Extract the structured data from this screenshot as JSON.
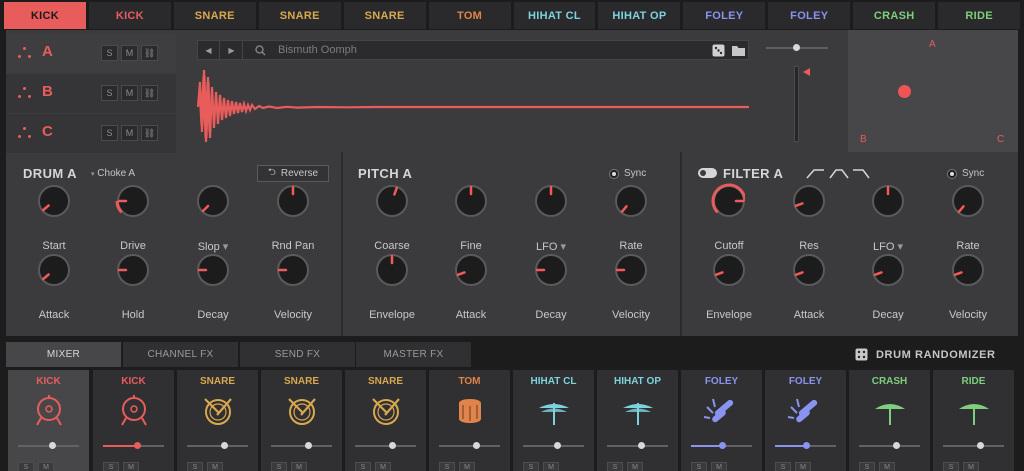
{
  "colors": {
    "kick": "#e95c5c",
    "snare": "#d9a84e",
    "tom": "#e0844b",
    "hihat": "#7cd3de",
    "foley": "#8a93ef",
    "crash": "#7fce7d",
    "ride": "#7fce7d"
  },
  "top_tabs": [
    {
      "label": "KICK",
      "color": "#e95c5c",
      "active": true
    },
    {
      "label": "KICK",
      "color": "#e95c5c"
    },
    {
      "label": "SNARE",
      "color": "#d9a84e"
    },
    {
      "label": "SNARE",
      "color": "#d9a84e"
    },
    {
      "label": "SNARE",
      "color": "#d9a84e"
    },
    {
      "label": "TOM",
      "color": "#e0844b"
    },
    {
      "label": "HIHAT CL",
      "color": "#7cd3de"
    },
    {
      "label": "HIHAT OP",
      "color": "#7cd3de"
    },
    {
      "label": "FOLEY",
      "color": "#8a93ef"
    },
    {
      "label": "FOLEY",
      "color": "#8a93ef"
    },
    {
      "label": "CRASH",
      "color": "#7fce7d"
    },
    {
      "label": "RIDE",
      "color": "#7fce7d"
    }
  ],
  "pads": [
    {
      "letter": "A",
      "s": "S",
      "m": "M"
    },
    {
      "letter": "B",
      "s": "S",
      "m": "M"
    },
    {
      "letter": "C",
      "s": "S",
      "m": "M"
    }
  ],
  "sample": {
    "name": "Bismuth Oomph",
    "prev_icon": "prev-arrow-icon",
    "next_icon": "next-arrow-icon"
  },
  "xy_pad": {
    "a": "A",
    "b": "B",
    "c": "C"
  },
  "drum": {
    "title": "DRUM A",
    "choke": "Choke A",
    "reverse": "Reverse",
    "knobs": [
      "Start",
      "Drive",
      "Slop",
      "Rnd Pan",
      "Attack",
      "Hold",
      "Decay",
      "Velocity"
    ]
  },
  "pitch": {
    "title": "PITCH A",
    "sync": "Sync",
    "knobs": [
      "Coarse",
      "Fine",
      "LFO",
      "Rate",
      "Envelope",
      "Attack",
      "Decay",
      "Velocity"
    ]
  },
  "filter": {
    "title": "FILTER A",
    "sync": "Sync",
    "knobs": [
      "Cutoff",
      "Res",
      "LFO",
      "Rate",
      "Envelope",
      "Attack",
      "Decay",
      "Velocity"
    ]
  },
  "lower_tabs": [
    "MIXER",
    "CHANNEL FX",
    "SEND FX",
    "MASTER FX"
  ],
  "randomizer": "DRUM RANDOMIZER",
  "strips": [
    {
      "label": "KICK",
      "color": "#e95c5c",
      "icon": "kick-drum-icon",
      "level": 0.55
    },
    {
      "label": "KICK",
      "color": "#e95c5c",
      "icon": "kick-drum-icon",
      "level": 0.55
    },
    {
      "label": "SNARE",
      "color": "#d9a84e",
      "icon": "snare-drum-icon",
      "level": 0.6
    },
    {
      "label": "SNARE",
      "color": "#d9a84e",
      "icon": "snare-drum-icon",
      "level": 0.6
    },
    {
      "label": "SNARE",
      "color": "#d9a84e",
      "icon": "snare-drum-icon",
      "level": 0.6
    },
    {
      "label": "TOM",
      "color": "#e0844b",
      "icon": "tom-drum-icon",
      "level": 0.6
    },
    {
      "label": "HIHAT CL",
      "color": "#7cd3de",
      "icon": "hihat-icon",
      "level": 0.55
    },
    {
      "label": "HIHAT OP",
      "color": "#7cd3de",
      "icon": "hihat-icon",
      "level": 0.55
    },
    {
      "label": "FOLEY",
      "color": "#8a93ef",
      "icon": "foley-icon",
      "level": 0.5
    },
    {
      "label": "FOLEY",
      "color": "#8a93ef",
      "icon": "foley-icon",
      "level": 0.5
    },
    {
      "label": "CRASH",
      "color": "#7fce7d",
      "icon": "cymbal-icon",
      "level": 0.6
    },
    {
      "label": "RIDE",
      "color": "#7fce7d",
      "icon": "cymbal-icon",
      "level": 0.6
    }
  ]
}
